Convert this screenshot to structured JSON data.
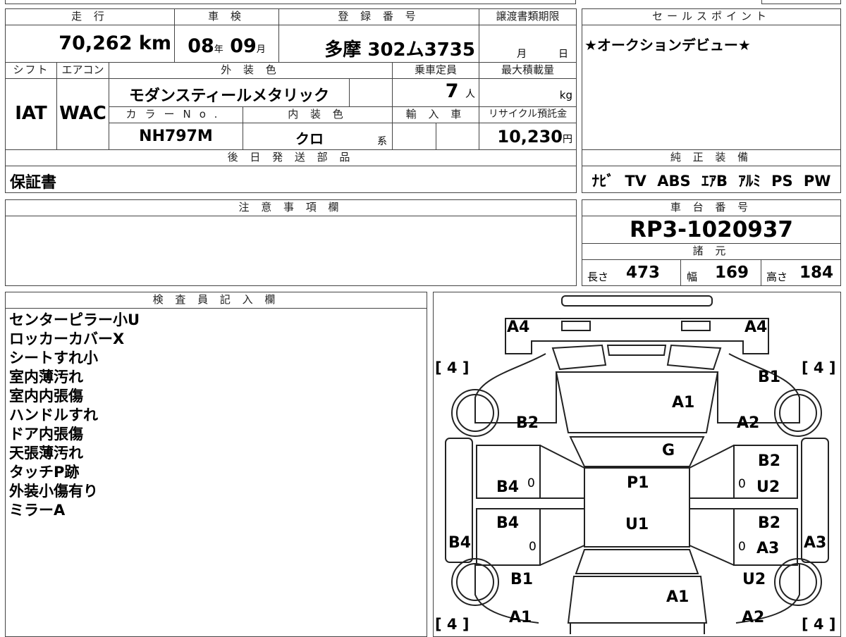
{
  "basic": {
    "mileage_label": "走 行",
    "mileage_value": "70,262",
    "mileage_unit": "km",
    "shaken_label": "車 検",
    "shaken_year": "08",
    "shaken_year_unit": "年",
    "shaken_month": "09",
    "shaken_month_unit": "月",
    "registration_label": "登 録 番 号",
    "registration_value": "多摩 302ム3735",
    "transfer_deadline_label": "譲渡書類期限",
    "transfer_month_unit": "月",
    "transfer_day_unit": "日"
  },
  "sales_point": {
    "label": "セールスポイント",
    "text": "★オークションデビュー★"
  },
  "specs": {
    "shift_label": "シフト",
    "shift_value": "IAT",
    "aircon_label": "エアコン",
    "aircon_value": "WAC",
    "exterior_color_label": "外 装 色",
    "exterior_color_value": "モダンスティールメタリック",
    "capacity_label": "乗車定員",
    "capacity_value": "7",
    "capacity_unit": "人",
    "max_load_label": "最大積載量",
    "max_load_unit": "kg",
    "color_no_label": "カラーNo.",
    "color_no_value": "NH797M",
    "interior_color_label": "内 装 色",
    "interior_color_value": "クロ",
    "interior_color_suffix": "系",
    "import_label": "輸 入 車",
    "recycle_label": "リサイクル預託金",
    "recycle_value": "10,230",
    "recycle_unit": "円"
  },
  "later_parts": {
    "label": "後 日 発 送 部 品",
    "value": "保証書"
  },
  "genuine_equipment": {
    "label": "純 正 装 備",
    "items": "ﾅﾋﾞ TV ABS ｴｱB ｱﾙﾐ PS PW"
  },
  "caution": {
    "label": "注 意 事 項 欄"
  },
  "chassis": {
    "label": "車 台 番 号",
    "value": "RP3-1020937"
  },
  "dimensions": {
    "label": "諸 元",
    "length_label": "長さ",
    "length_value": "473",
    "width_label": "幅",
    "width_value": "169",
    "height_label": "高さ",
    "height_value": "184"
  },
  "inspector": {
    "label": "検 査 員 記 入 欄",
    "notes": [
      "センターピラー小U",
      "ロッカーカバーX",
      "シートすれ小",
      "室内薄汚れ",
      "室内内張傷",
      "ハンドルすれ",
      "ドア内張傷",
      "天張薄汚れ",
      "タッチP跡",
      "外装小傷有り",
      "ミラーA"
    ]
  },
  "diagram": {
    "tire_front_left": "[ 4 ]",
    "tire_front_right": "[ 4 ]",
    "tire_rear_left": "[ 4 ]",
    "tire_rear_right": "[ 4 ]",
    "mark_front_left_corner": "A4",
    "mark_front_right_corner": "A4",
    "mark_front_right_fender": "B1",
    "mark_hood": "A1",
    "mark_left_fender": "B2",
    "mark_right_fender": "A2",
    "mark_windshield": "G",
    "mark_right_front_door_upper": "B2",
    "mark_right_front_door_lower": "U2",
    "mark_left_front_door": "B4",
    "mark_roof_front": "P1",
    "mark_roof_rear": "U1",
    "mark_left_rear_door": "B4",
    "mark_right_rear_door_upper": "B2",
    "mark_right_rear_door_lower": "A3",
    "mark_left_rocker": "B4",
    "mark_right_rocker": "A3",
    "mark_left_rear_fender": "B1",
    "mark_right_rear_fender": "U2",
    "mark_rear_gate": "A1",
    "mark_rear_left_corner": "A1",
    "mark_rear_right_corner": "A2",
    "zero_left_front": "0",
    "zero_left_rear": "0",
    "zero_right_front": "0",
    "zero_right_rear": "0"
  }
}
